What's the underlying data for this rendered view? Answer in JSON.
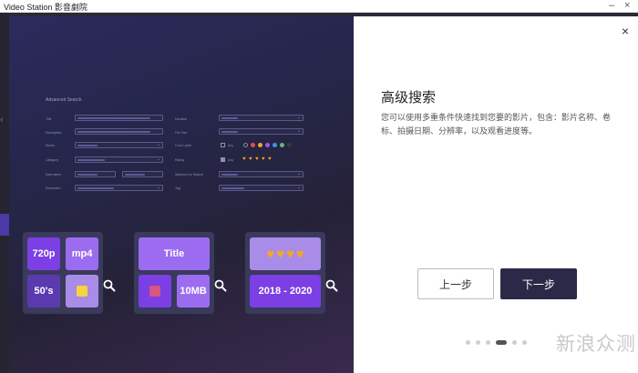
{
  "window": {
    "title": "Video Station 影音劇院",
    "minimize_label": "–",
    "close_label": "×"
  },
  "advanced_search": {
    "title": "Advanced Search",
    "left_labels": [
      "Title",
      "Description",
      "Studio",
      "Category",
      "Date taken",
      "Resolution"
    ],
    "right_labels": [
      "Duration",
      "File Size",
      "Color Label",
      "Rating",
      "Watched (or Status)",
      "Tag"
    ],
    "any_label": "Any",
    "label_colors": [
      "#8a8a8a",
      "#e0514f",
      "#f0a23a",
      "#8a63e8",
      "#4a8fe0",
      "#5cbf68",
      "#3a3a3a"
    ]
  },
  "cards": {
    "card1": {
      "tile1": "720p",
      "tile2": "mp4",
      "tile3": "50's"
    },
    "card2": {
      "tile1": "Title",
      "tile3": "10MB"
    },
    "card3": {
      "tile2": "2018 - 2020"
    }
  },
  "panel": {
    "close_icon": "×",
    "heading": "高级搜索",
    "description": "您可以使用多重条件快速找到您要的影片，包含：影片名称、卷标、拍摄日期、分辨率，以及观看进度等。",
    "prev_button": "上一步",
    "next_button": "下一步",
    "pager": {
      "total": 6,
      "active": 4
    },
    "watermark": "新浪众测"
  }
}
